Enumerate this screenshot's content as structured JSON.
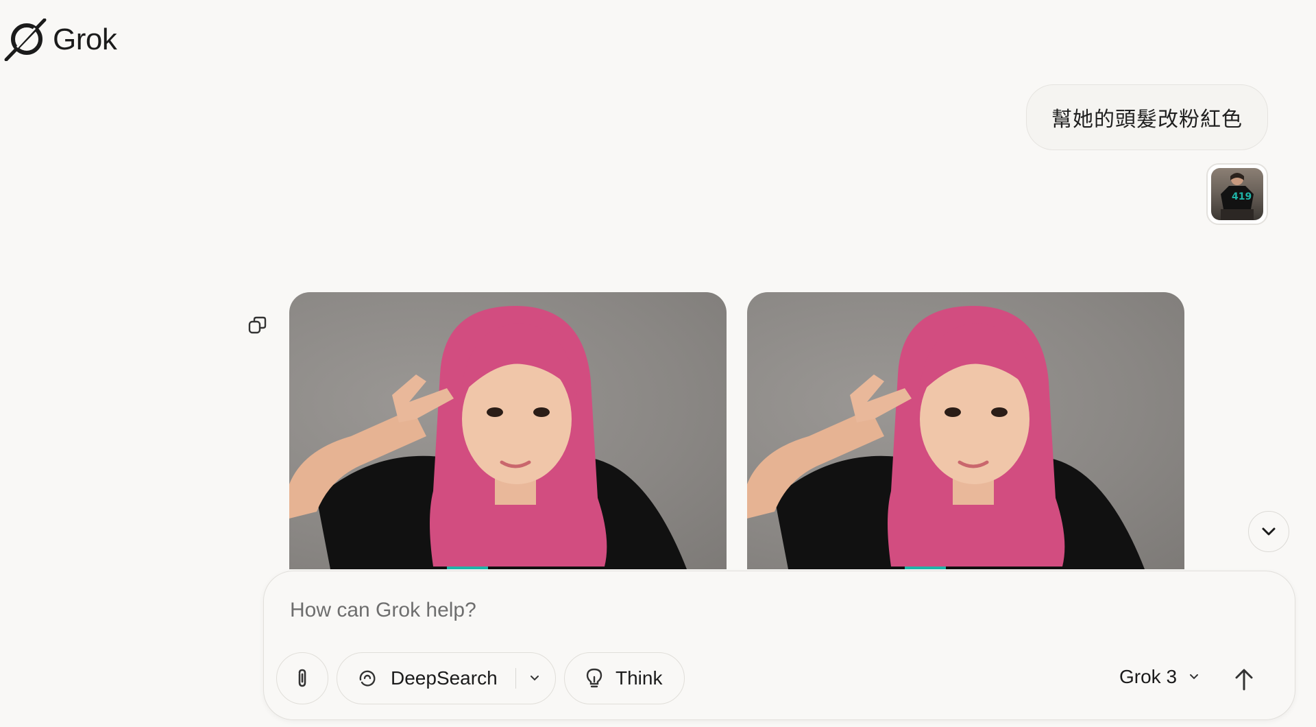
{
  "app": {
    "logo_text": "Grok"
  },
  "conversation": {
    "user_message": "幫她的頭髮改粉紅色",
    "user_attachment_icon": "image-thumbnail"
  },
  "composer": {
    "placeholder": "How can Grok help?",
    "deepsearch_label": "DeepSearch",
    "think_label": "Think",
    "model_label": "Grok 3"
  },
  "icons": {
    "logo": "grok-logo-icon",
    "copy": "copy-icon",
    "scroll": "chevron-down-icon",
    "attach": "paperclip-icon",
    "deepsearch": "deepsearch-swirl-icon",
    "think": "lightbulb-icon",
    "send": "arrow-up-icon"
  },
  "colors": {
    "background": "#f9f8f6",
    "hair_pink": "#d24d80",
    "shirt": "#111111",
    "shirt_print": "#1fb5a8"
  }
}
